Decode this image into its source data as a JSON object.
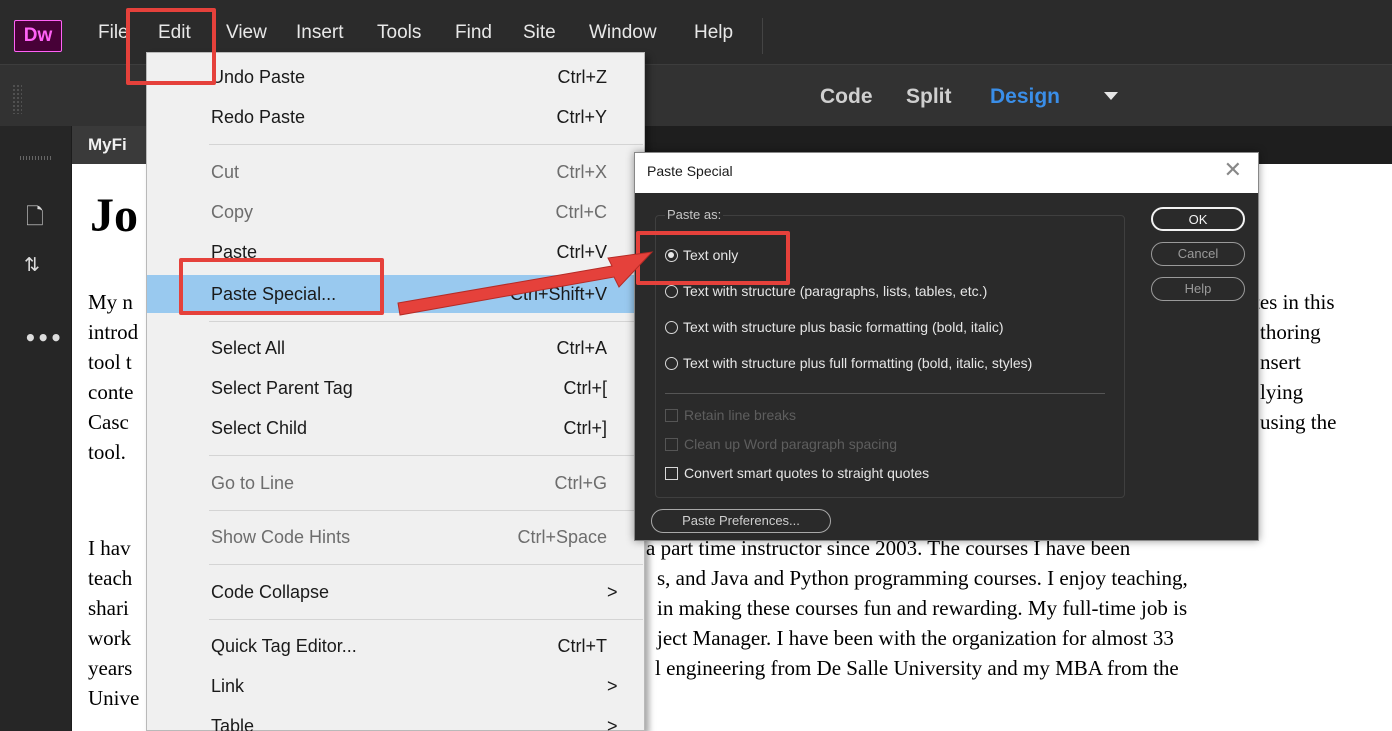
{
  "app": {
    "logo": "Dw",
    "menu": [
      "File",
      "Edit",
      "View",
      "Insert",
      "Tools",
      "Find",
      "Site",
      "Window",
      "Help"
    ]
  },
  "view_switcher": {
    "code": "Code",
    "split": "Split",
    "design": "Design",
    "active": "Design"
  },
  "document": {
    "tab": "MyFi",
    "heading": "Jo",
    "para1_left": [
      "My n",
      "introd",
      "tool t",
      "conte",
      "Casc",
      "tool."
    ],
    "para1_right": [
      "tes in this",
      "thoring",
      "nsert",
      "lying",
      "using the"
    ],
    "para2_left": [
      "I hav",
      "teach",
      "shari",
      "work",
      "years",
      "Unive"
    ],
    "para2_right": [
      "a part time instructor since 2003. The courses I have been",
      "s, and Java and Python programming courses. I enjoy teaching,",
      "in making these courses fun and rewarding. My full-time job is",
      "ject Manager. I have been with the organization for almost 33",
      "l engineering from De Salle University and my MBA from the"
    ]
  },
  "edit_menu": {
    "items": [
      {
        "label": "Undo Paste",
        "shortcut": "Ctrl+Z"
      },
      {
        "label": "Redo Paste",
        "shortcut": "Ctrl+Y"
      },
      {
        "label": "Cut",
        "shortcut": "Ctrl+X"
      },
      {
        "label": "Copy",
        "shortcut": "Ctrl+C"
      },
      {
        "label": "Paste",
        "shortcut": "Ctrl+V"
      },
      {
        "label": "Paste Special...",
        "shortcut": "Ctrl+Shift+V"
      },
      {
        "label": "Select All",
        "shortcut": "Ctrl+A"
      },
      {
        "label": "Select Parent Tag",
        "shortcut": "Ctrl+["
      },
      {
        "label": "Select Child",
        "shortcut": "Ctrl+]"
      },
      {
        "label": "Go to Line",
        "shortcut": "Ctrl+G"
      },
      {
        "label": "Show Code Hints",
        "shortcut": "Ctrl+Space"
      },
      {
        "label": "Code Collapse",
        "shortcut": ">"
      },
      {
        "label": "Quick Tag Editor...",
        "shortcut": "Ctrl+T"
      },
      {
        "label": "Link",
        "shortcut": ">"
      },
      {
        "label": "Table",
        "shortcut": ">"
      }
    ]
  },
  "paste_special": {
    "title": "Paste Special",
    "close": "✕",
    "group_label": "Paste as:",
    "options": [
      "Text only",
      "Text with structure (paragraphs, lists, tables, etc.)",
      "Text with structure plus basic formatting (bold, italic)",
      "Text with structure plus full formatting (bold, italic, styles)"
    ],
    "selected": "Text only",
    "checkboxes": [
      {
        "label": "Retain line breaks",
        "enabled": false
      },
      {
        "label": "Clean up Word paragraph spacing",
        "enabled": false
      },
      {
        "label": "Convert smart quotes to straight quotes",
        "enabled": true
      }
    ],
    "buttons": {
      "ok": "OK",
      "cancel": "Cancel",
      "help": "Help"
    },
    "preferences_button": "Paste Preferences..."
  },
  "colors": {
    "highlight": "#99c9ef",
    "annotation_red": "#e5413b",
    "design_blue": "#3a8ee8",
    "dw_purple": "#470137",
    "dw_pink": "#ff61f6"
  }
}
